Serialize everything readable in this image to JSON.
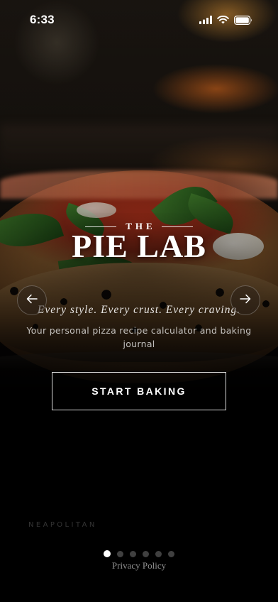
{
  "status_bar": {
    "time": "6:33",
    "icons": [
      "signal-icon",
      "wifi-icon",
      "battery-icon"
    ]
  },
  "brand": {
    "prefix": "THE",
    "title": "PIE LAB"
  },
  "hero": {
    "tagline": "Every style. Every crust. Every craving.",
    "subtitle": "Your personal pizza recipe calculator and baking journal"
  },
  "carousel": {
    "prev_icon": "arrow-left-icon",
    "next_icon": "arrow-right-icon",
    "current_style": "NEAPOLITAN",
    "page_count": 6,
    "active_index": 0
  },
  "cta": {
    "label": "START BAKING"
  },
  "footer": {
    "privacy_label": "Privacy Policy"
  },
  "colors": {
    "background": "#000000",
    "text": "#ffffff",
    "dot_inactive": "#404040"
  }
}
